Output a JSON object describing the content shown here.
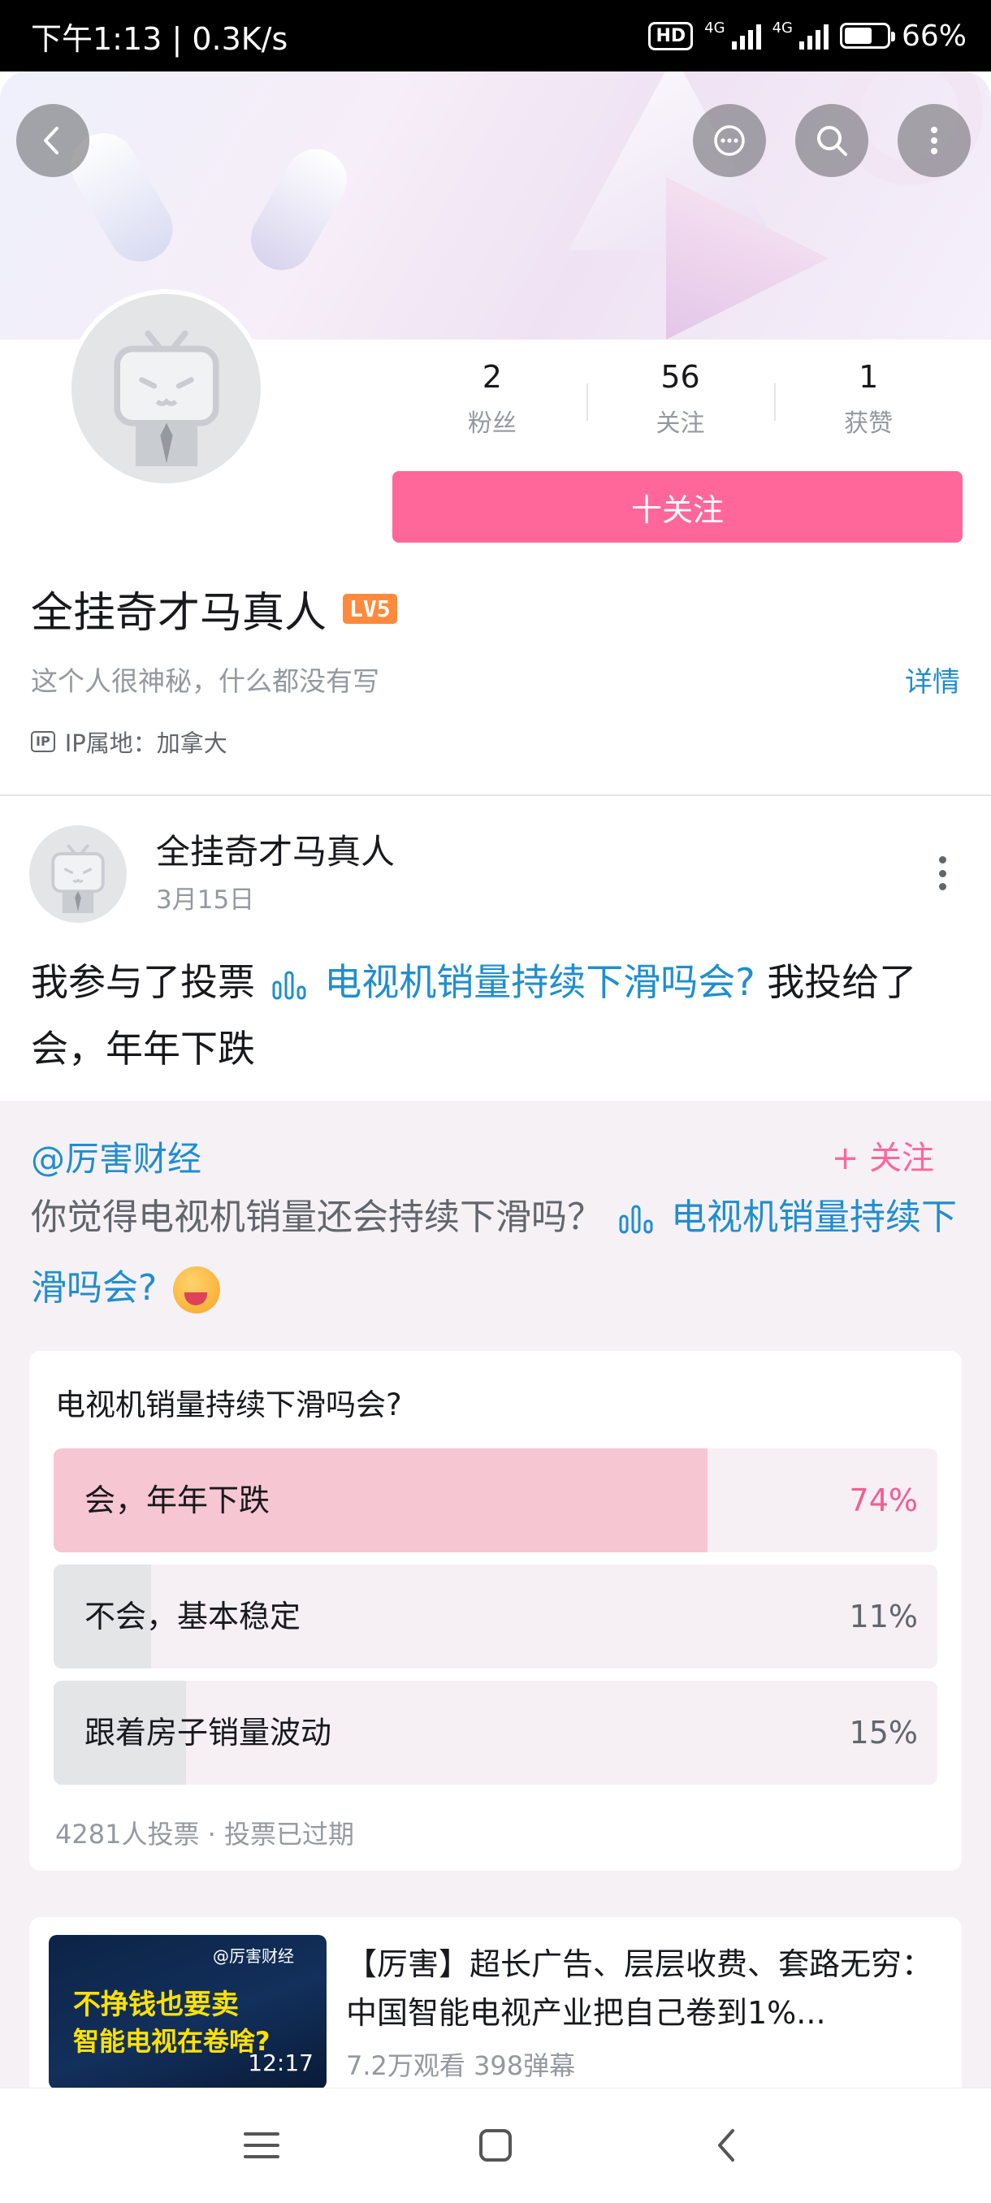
{
  "status_bar": {
    "time": "下午1:13",
    "speed": "0.3K/s",
    "hd": "HD",
    "net1": "4G",
    "net2": "4G",
    "battery": "66%"
  },
  "profile": {
    "fans_count": "2",
    "fans_label": "粉丝",
    "following_count": "56",
    "following_label": "关注",
    "likes_count": "1",
    "likes_label": "获赞",
    "follow_button": "十关注",
    "name": "全挂奇才马真人",
    "level": "LV5",
    "bio": "这个人很神秘，什么都没有写",
    "detail_link": "详情",
    "ip_icon": "IP",
    "ip_location": "IP属地：加拿大"
  },
  "post": {
    "author": "全挂奇才马真人",
    "date": "3月15日",
    "text_prefix": "我参与了投票",
    "vote_link": "电视机销量持续下滑吗会?",
    "text_suffix": "我投给了会，年年下跌"
  },
  "repost": {
    "author": "@厉害财经",
    "follow": "+ 关注",
    "text": "你觉得电视机销量还会持续下滑吗？",
    "vote_link": "电视机销量持续下滑吗会?",
    "vote": {
      "title": "电视机销量持续下滑吗会?",
      "options": [
        {
          "label": "会，年年下跌",
          "percent": "74%",
          "value": 0.74
        },
        {
          "label": "不会，基本稳定",
          "percent": "11%",
          "value": 0.11
        },
        {
          "label": "跟着房子销量波动",
          "percent": "15%",
          "value": 0.15
        }
      ],
      "footer": "4281人投票 · 投票已过期"
    },
    "video": {
      "thumb_tag": "@厉害财经",
      "thumb_line1": "不挣钱也要卖",
      "thumb_line2": "智能电视在卷啥?",
      "duration": "12:17",
      "title": "【厉害】超长广告、层层收费、套路无穷：中国智能电视产业把自己卷到1%...",
      "meta": "7.2万观看 398弹幕"
    }
  },
  "colors": {
    "accent_pink": "#ff6699",
    "link_blue": "#1f8ecf",
    "vote_fill_top": "#f7c6d3"
  },
  "icons": {
    "back": "back-icon",
    "message": "message-icon",
    "search": "search-icon",
    "more": "more-icon",
    "nav_menu": "menu-icon",
    "nav_home": "home-icon",
    "nav_back": "back-nav-icon"
  }
}
